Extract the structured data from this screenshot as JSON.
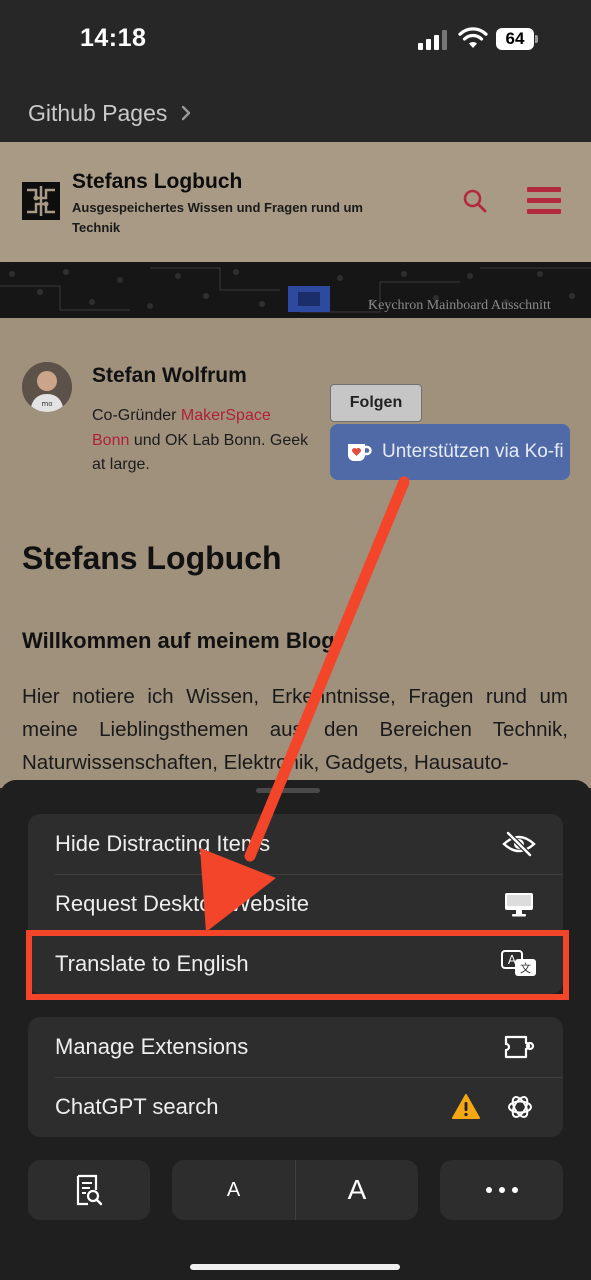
{
  "status_bar": {
    "time": "14:18",
    "battery": "64"
  },
  "browser": {
    "title": "Github Pages"
  },
  "site": {
    "title": "Stefans Logbuch",
    "tagline": "Ausgespeichertes Wissen und Fragen rund um Technik",
    "banner_caption": "Keychron Mainboard Ausschnitt",
    "accent_color": "#b32a3c"
  },
  "author": {
    "name": "Stefan Wolfrum",
    "bio_prefix": "Co-Gründer ",
    "bio_link": "MakerSpace Bonn",
    "bio_suffix": " und OK Lab Bonn. Geek at large.",
    "follow_label": "Folgen",
    "kofi_label": "Unterstützen via Ko-fi"
  },
  "content": {
    "blog_title": "Stefans Logbuch",
    "welcome": "Willkommen auf meinem Blog!",
    "intro": "Hier notiere ich Wissen, Erkenntnisse, Fragen rund um meine Lieblingsthemen aus den Bereichen Technik, Naturwissenschaften, Elektronik, Gadgets, Hausauto-"
  },
  "menu": {
    "group1": [
      {
        "label": "Hide Distracting Items",
        "icon": "eye-slash-icon"
      },
      {
        "label": "Request Desktop Website",
        "icon": "desktop-icon"
      },
      {
        "label": "Translate to English",
        "icon": "translate-icon"
      }
    ],
    "group2": [
      {
        "label": "Manage Extensions",
        "icon": "puzzle-icon"
      },
      {
        "label": "ChatGPT search",
        "icon": "openai-icon",
        "warning_icon": "warning-icon"
      }
    ],
    "font_small": "A",
    "font_large": "A",
    "more": "•••"
  },
  "annotation": {
    "color": "#f2452a"
  }
}
